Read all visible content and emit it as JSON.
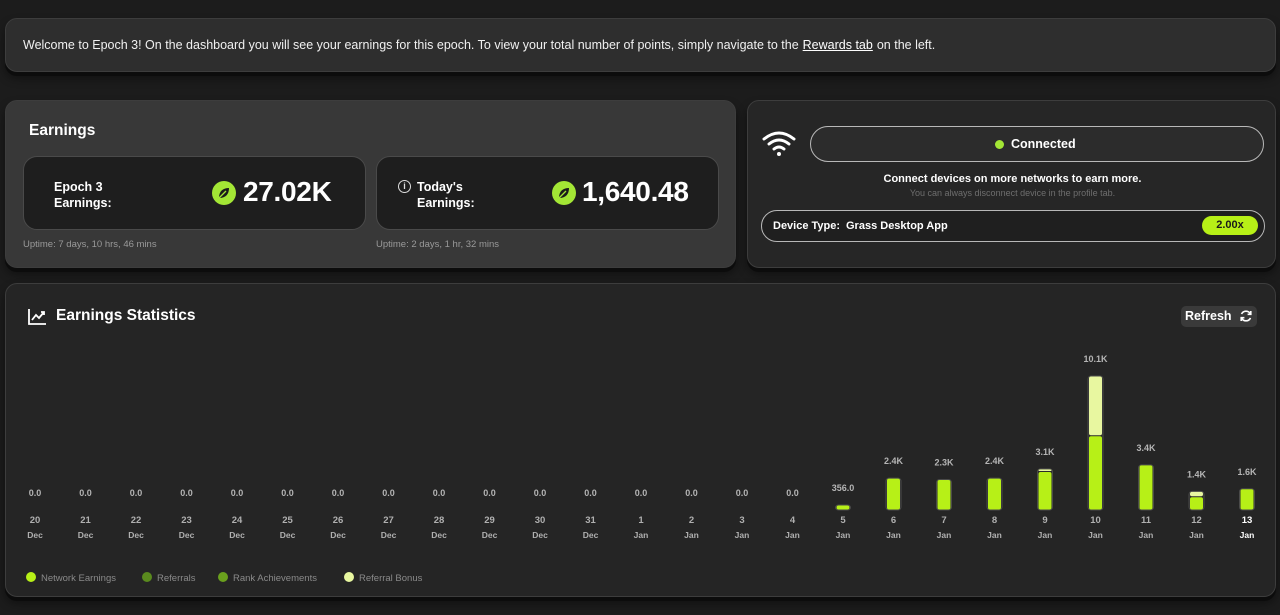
{
  "banner": {
    "text_before": "Welcome to Epoch 3! On the dashboard you will see your earnings for this epoch. To view your total number of points, simply navigate to the",
    "link_text": "Rewards tab",
    "text_after": "on the left."
  },
  "earnings": {
    "title": "Earnings",
    "epoch_label": "Epoch 3\nEarnings:",
    "epoch_value": "27.02K",
    "epoch_uptime": "Uptime: 7 days, 10 hrs, 46 mins",
    "today_label": "Today's\nEarnings:",
    "today_value": "1,640.48",
    "today_uptime": "Uptime: 2 days, 1 hr, 32 mins",
    "info_icon": "info-icon",
    "leaf_icon": "leaf-icon"
  },
  "connection": {
    "status": "Connected",
    "message": "Connect devices on more networks to earn more.",
    "sub_message": "You can always disconnect device in the profile tab.",
    "device_label": "Device Type:",
    "device_value": "Grass Desktop App",
    "multiplier": "2.00x",
    "status_color": "#a3e635"
  },
  "stats": {
    "title": "Earnings Statistics",
    "refresh_label": "Refresh"
  },
  "colors": {
    "network": "#b7f017",
    "referrals": "#5a8a1e",
    "rank": "#6aa01d",
    "referral_bonus": "#e8f7a0",
    "accent": "#a3e635"
  },
  "chart_data": {
    "type": "bar",
    "categories": [
      "20 Dec",
      "21 Dec",
      "22 Dec",
      "23 Dec",
      "24 Dec",
      "25 Dec",
      "26 Dec",
      "27 Dec",
      "28 Dec",
      "29 Dec",
      "30 Dec",
      "31 Dec",
      "1 Jan",
      "2 Jan",
      "3 Jan",
      "4 Jan",
      "5 Jan",
      "6 Jan",
      "7 Jan",
      "8 Jan",
      "9 Jan",
      "10 Jan",
      "11 Jan",
      "12 Jan",
      "13 Jan"
    ],
    "day_labels": [
      "20",
      "21",
      "22",
      "23",
      "24",
      "25",
      "26",
      "27",
      "28",
      "29",
      "30",
      "31",
      "1",
      "2",
      "3",
      "4",
      "5",
      "6",
      "7",
      "8",
      "9",
      "10",
      "11",
      "12",
      "13"
    ],
    "month_labels": [
      "Dec",
      "Dec",
      "Dec",
      "Dec",
      "Dec",
      "Dec",
      "Dec",
      "Dec",
      "Dec",
      "Dec",
      "Dec",
      "Dec",
      "Jan",
      "Jan",
      "Jan",
      "Jan",
      "Jan",
      "Jan",
      "Jan",
      "Jan",
      "Jan",
      "Jan",
      "Jan",
      "Jan",
      "Jan"
    ],
    "value_labels": [
      "0.0",
      "0.0",
      "0.0",
      "0.0",
      "0.0",
      "0.0",
      "0.0",
      "0.0",
      "0.0",
      "0.0",
      "0.0",
      "0.0",
      "0.0",
      "0.0",
      "0.0",
      "0.0",
      "356.0",
      "2.4K",
      "2.3K",
      "2.4K",
      "3.1K",
      "10.1K",
      "3.4K",
      "1.4K",
      "1.6K"
    ],
    "series": [
      {
        "name": "Network Earnings",
        "values": [
          0,
          0,
          0,
          0,
          0,
          0,
          0,
          0,
          0,
          0,
          0,
          0,
          0,
          0,
          0,
          0,
          356,
          2400,
          2300,
          2400,
          2900,
          5600,
          3400,
          1000,
          1600
        ]
      },
      {
        "name": "Referrals",
        "values": [
          0,
          0,
          0,
          0,
          0,
          0,
          0,
          0,
          0,
          0,
          0,
          0,
          0,
          0,
          0,
          0,
          0,
          0,
          0,
          0,
          0,
          0,
          0,
          0,
          0
        ]
      },
      {
        "name": "Rank Achievements",
        "values": [
          0,
          0,
          0,
          0,
          0,
          0,
          0,
          0,
          0,
          0,
          0,
          0,
          0,
          0,
          0,
          0,
          0,
          0,
          0,
          0,
          0,
          0,
          0,
          0,
          0
        ]
      },
      {
        "name": "Referral Bonus",
        "values": [
          0,
          0,
          0,
          0,
          0,
          0,
          0,
          0,
          0,
          0,
          0,
          0,
          0,
          0,
          0,
          0,
          0,
          0,
          0,
          0,
          200,
          4500,
          0,
          400,
          0
        ]
      }
    ],
    "highlighted_category": "13 Jan",
    "ylim": [
      0,
      10100
    ],
    "grid": false,
    "legend_position": "bottom-left"
  }
}
